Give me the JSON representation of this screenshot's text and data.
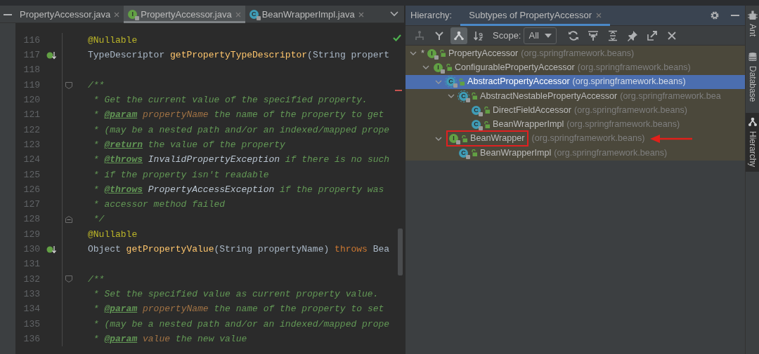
{
  "editor": {
    "tabs": [
      {
        "label": "PropertyAccessor.java",
        "selected": false
      },
      {
        "label": "PropertyAccessor.java",
        "icon_letter": "I",
        "kind": "interface",
        "selected": true
      },
      {
        "label": "BeanWrapperImpl.java",
        "icon_letter": "C",
        "kind": "class",
        "selected": false
      }
    ],
    "lines": [
      {
        "number": "116",
        "tokens": [
          {
            "text": "@Nullable",
            "kind": "annotation"
          }
        ]
      },
      {
        "number": "117",
        "implemented": true,
        "tokens": [
          {
            "text": "TypeDescriptor ",
            "kind": "plain"
          },
          {
            "text": "getPropertyTypeDescriptor",
            "kind": "method"
          },
          {
            "text": "(String propert",
            "kind": "plain"
          }
        ]
      },
      {
        "number": "118"
      },
      {
        "number": "119",
        "fold_start": true,
        "tokens": [
          {
            "text": "/**",
            "kind": "comment"
          }
        ]
      },
      {
        "number": "120",
        "tokens": [
          {
            "text": " * Get the current value of the specified property.",
            "kind": "comment"
          }
        ]
      },
      {
        "number": "121",
        "tokens": [
          {
            "text": " * ",
            "kind": "comment"
          },
          {
            "text": "@param",
            "kind": "doctag"
          },
          {
            "text": " propertyName",
            "kind": "docparam"
          },
          {
            "text": " the name of the property to get",
            "kind": "comment"
          }
        ]
      },
      {
        "number": "122",
        "tokens": [
          {
            "text": " * (may be a nested path and/or an indexed/mapped prope",
            "kind": "comment"
          }
        ]
      },
      {
        "number": "123",
        "tokens": [
          {
            "text": " * ",
            "kind": "comment"
          },
          {
            "text": "@return",
            "kind": "doctag"
          },
          {
            "text": " the value of the property",
            "kind": "comment"
          }
        ]
      },
      {
        "number": "124",
        "tokens": [
          {
            "text": " * ",
            "kind": "comment"
          },
          {
            "text": "@throws",
            "kind": "doctag"
          },
          {
            "text": " InvalidPropertyException",
            "kind": "doctype"
          },
          {
            "text": " if there is no such",
            "kind": "comment"
          }
        ]
      },
      {
        "number": "125",
        "tokens": [
          {
            "text": " * if the property isn't readable",
            "kind": "comment"
          }
        ]
      },
      {
        "number": "126",
        "tokens": [
          {
            "text": " * ",
            "kind": "comment"
          },
          {
            "text": "@throws",
            "kind": "doctag"
          },
          {
            "text": " PropertyAccessException",
            "kind": "doctype"
          },
          {
            "text": " if the property was",
            "kind": "comment"
          }
        ]
      },
      {
        "number": "127",
        "tokens": [
          {
            "text": " * accessor method failed",
            "kind": "comment"
          }
        ]
      },
      {
        "number": "128",
        "fold_end": true,
        "tokens": [
          {
            "text": " */",
            "kind": "comment"
          }
        ]
      },
      {
        "number": "129",
        "tokens": [
          {
            "text": "@Nullable",
            "kind": "annotation"
          }
        ]
      },
      {
        "number": "130",
        "implemented": true,
        "tokens": [
          {
            "text": "Object ",
            "kind": "plain"
          },
          {
            "text": "getPropertyValue",
            "kind": "method"
          },
          {
            "text": "(String propertyName) ",
            "kind": "plain"
          },
          {
            "text": "throws",
            "kind": "keyword"
          },
          {
            "text": " Bea",
            "kind": "plain"
          }
        ]
      },
      {
        "number": "131"
      },
      {
        "number": "132",
        "fold_start": true,
        "tokens": [
          {
            "text": "/**",
            "kind": "comment"
          }
        ]
      },
      {
        "number": "133",
        "tokens": [
          {
            "text": " * Set the specified value as current property value.",
            "kind": "comment"
          }
        ]
      },
      {
        "number": "134",
        "tokens": [
          {
            "text": " * ",
            "kind": "comment"
          },
          {
            "text": "@param",
            "kind": "doctag"
          },
          {
            "text": " propertyName",
            "kind": "docparam"
          },
          {
            "text": " the name of the property to set",
            "kind": "comment"
          }
        ]
      },
      {
        "number": "135",
        "tokens": [
          {
            "text": " * (may be a nested path and/or an indexed/mapped prope",
            "kind": "comment"
          }
        ]
      },
      {
        "number": "136",
        "tokens": [
          {
            "text": " * ",
            "kind": "comment"
          },
          {
            "text": "@param",
            "kind": "doctag"
          },
          {
            "text": " value",
            "kind": "docparam"
          },
          {
            "text": " the new value",
            "kind": "comment"
          }
        ]
      }
    ]
  },
  "hierarchy": {
    "label": "Hierarchy:",
    "tabs": [
      {
        "label": "Subtypes of PropertyAccessor",
        "selected": true
      }
    ],
    "toolbar": {
      "buttons": [
        {
          "selected": false,
          "disabled": true
        },
        {
          "selected": false,
          "disabled": false
        },
        {
          "selected": true,
          "disabled": false
        },
        {
          "selected": false,
          "disabled": false
        }
      ],
      "scope_label": "Scope:",
      "scope_value": "All"
    },
    "tree": [
      {
        "prefix": "*",
        "name": "PropertyAccessor",
        "package": "(org.springframework.beans)",
        "icon_letter": "I",
        "kind": "interface",
        "expanded": true,
        "selected": false,
        "children": [
          {
            "name": "ConfigurablePropertyAccessor",
            "package": "(org.springframework.beans)",
            "icon_letter": "I",
            "kind": "interface",
            "expanded": true,
            "selected": false,
            "children": [
              {
                "name": "AbstractPropertyAccessor",
                "package": "(org.springframework.beans)",
                "icon_letter": "C",
                "kind": "abstract_class",
                "expanded": true,
                "selected": true,
                "children": [
                  {
                    "name": "AbstractNestablePropertyAccessor",
                    "package": "(org.springframework.bea",
                    "icon_letter": "C",
                    "kind": "abstract_class",
                    "expanded": true,
                    "selected": false,
                    "children": [
                      {
                        "name": "DirectFieldAccessor",
                        "package": "(org.springframework.beans)",
                        "icon_letter": "C",
                        "kind": "class",
                        "selected": false
                      },
                      {
                        "name": "BeanWrapperImpl",
                        "package": "(org.springframework.beans)",
                        "icon_letter": "C",
                        "kind": "class",
                        "selected": false
                      }
                    ]
                  }
                ]
              },
              {
                "name": "BeanWrapper",
                "package": "(org.springframework.beans)",
                "icon_letter": "I",
                "kind": "interface",
                "expanded": true,
                "selected": false,
                "highlighted": true,
                "children": [
                  {
                    "name": "BeanWrapperImpl",
                    "package": "(org.springframework.beans)",
                    "icon_letter": "C",
                    "kind": "class",
                    "selected": false
                  }
                ]
              }
            ]
          }
        ]
      }
    ]
  },
  "tool_windows": [
    {
      "label": "Ant",
      "selected": false
    },
    {
      "label": "Database",
      "selected": false
    },
    {
      "label": "Hierarchy",
      "selected": true
    }
  ]
}
